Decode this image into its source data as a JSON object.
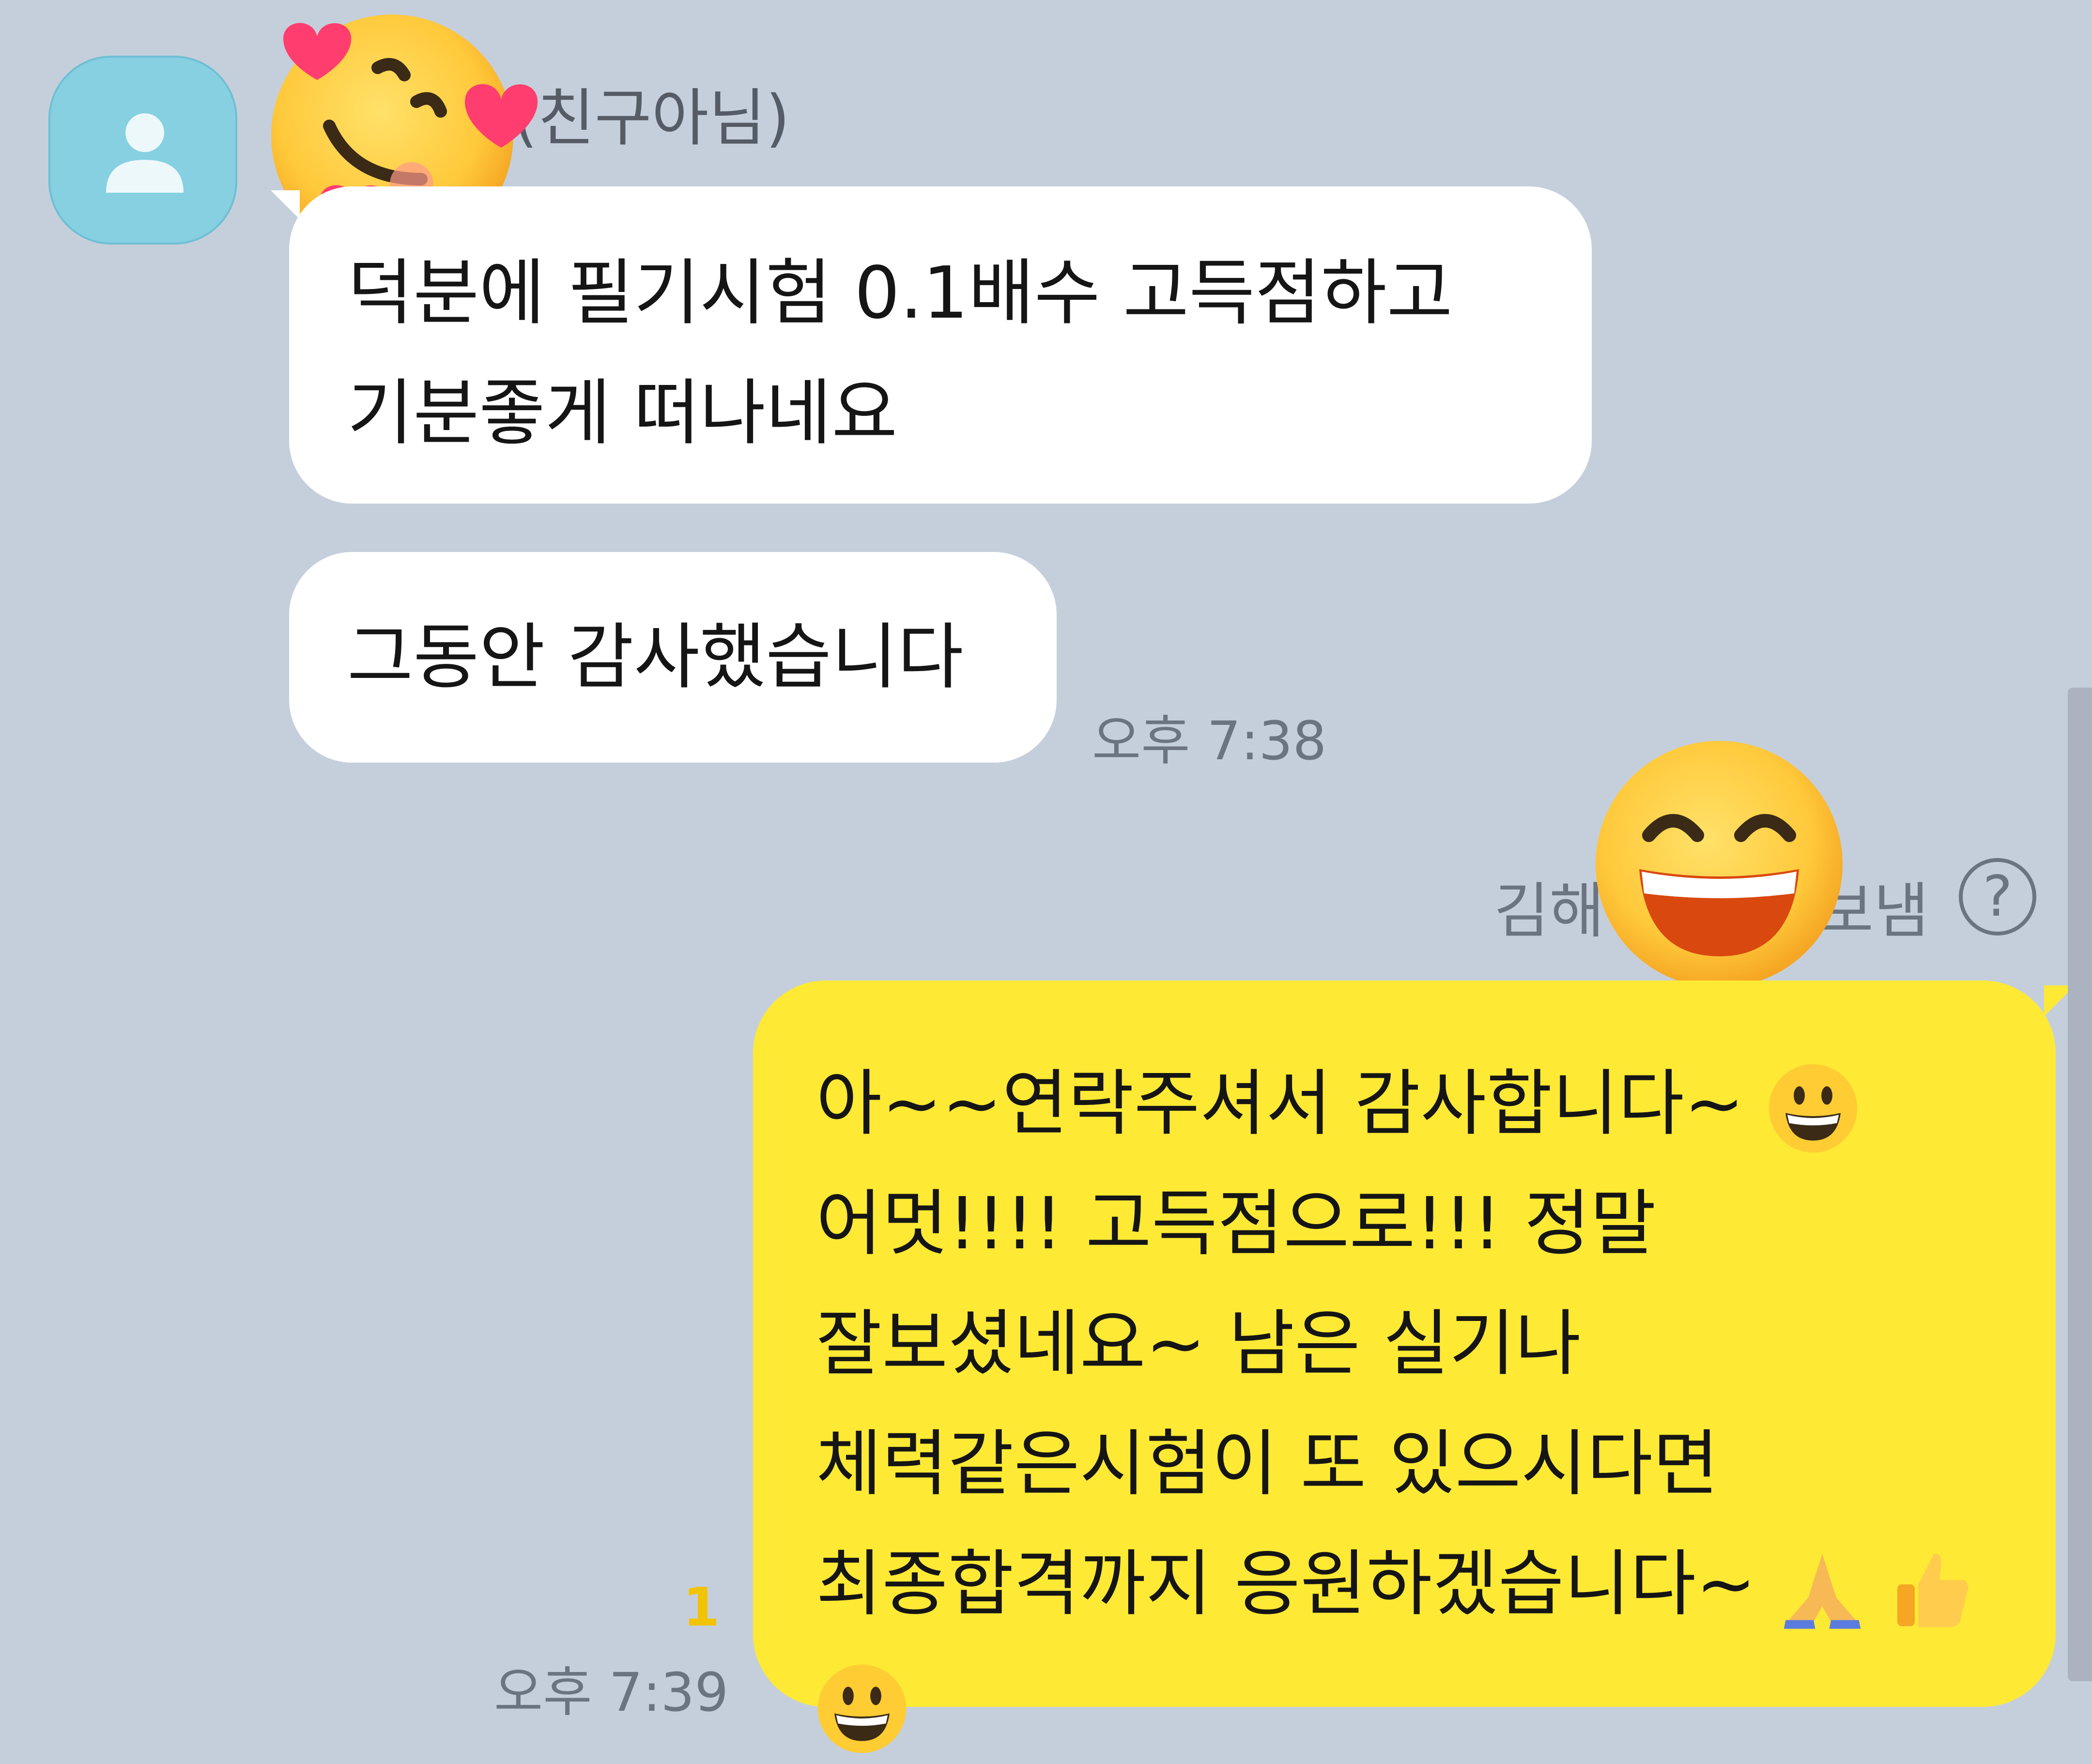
{
  "chat": {
    "sender": {
      "name_suffix": "(친구아님)",
      "avatar_icon": "person-icon"
    },
    "incoming": [
      {
        "lines": [
          "덕분에 필기시험 0.1배수 고득점하고",
          "기분좋게 떠나네요"
        ]
      },
      {
        "lines": [
          "그동안 감사했습니다"
        ]
      }
    ],
    "incoming_time": "오후 7:38",
    "outgoing_label": {
      "name": "김해",
      "status": "보냄"
    },
    "outgoing": {
      "lines": [
        "아~~연락주셔서 감사합니다~",
        "어멋!!!! 고득점으로!!! 정말",
        "잘보셨네요~ 남은 실기나",
        "체력같은시험이 또 있으시다면",
        "최종합격까지 응원하겠습니다~"
      ],
      "emojis": [
        "grinning-face-emoji",
        "folded-hands-emoji",
        "thumbs-up-emoji",
        "grinning-face-emoji"
      ]
    },
    "unread_count": "1",
    "outgoing_time": "오후 7:39"
  },
  "icons": {
    "help": "?"
  },
  "colors": {
    "background": "#c5cfdc",
    "incoming_bubble": "#ffffff",
    "outgoing_bubble": "#fee934",
    "unread": "#f2c300"
  }
}
